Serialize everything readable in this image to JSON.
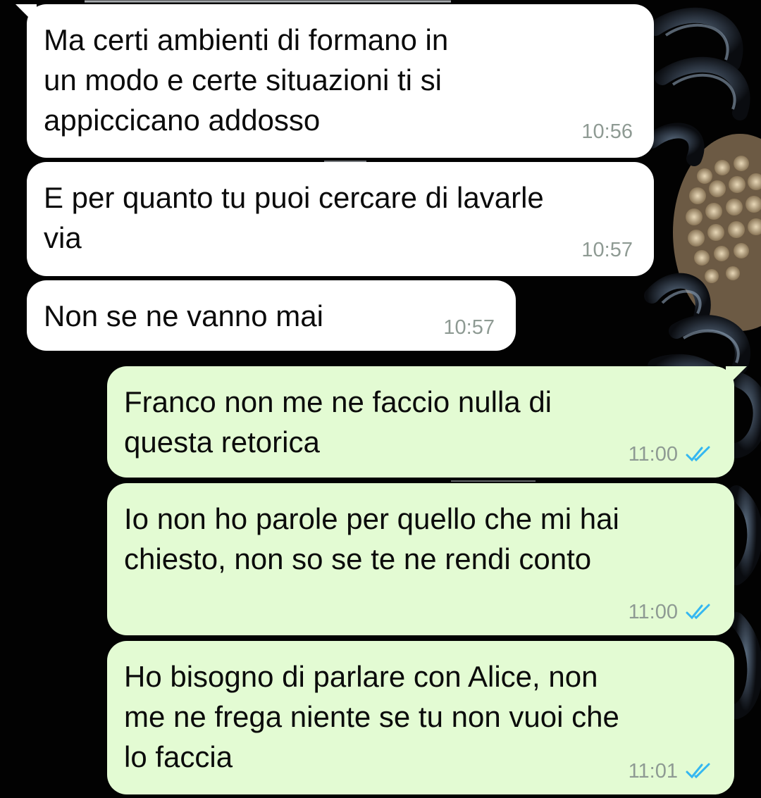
{
  "messages": [
    {
      "direction": "in",
      "text": "Ma certi ambienti di formano in\nun modo e certe situazioni ti si\nappiccicano addosso",
      "time": "10:56"
    },
    {
      "direction": "in",
      "text": "E per quanto tu puoi cercare di lavarle\nvia",
      "time": "10:57"
    },
    {
      "direction": "in",
      "text": "Non se ne vanno mai",
      "time": "10:57"
    },
    {
      "direction": "out",
      "text": "Franco non me ne faccio nulla di\nquesta retorica",
      "time": "11:00",
      "status": "read"
    },
    {
      "direction": "out",
      "text": "Io non ho parole per quello che mi hai\nchiesto, non so se te ne rendi conto",
      "time": "11:00",
      "status": "read"
    },
    {
      "direction": "out",
      "text": "Ho bisogno di parlare con Alice, non\nme ne frega niente se tu non vuoi che\nlo faccia",
      "time": "11:01",
      "status": "read"
    }
  ],
  "colors": {
    "incoming_bubble": "#ffffff",
    "outgoing_bubble": "#e3fbd3",
    "timestamp": "#8e9a93",
    "read_tick": "#34b7f1",
    "wallpaper": "#020202"
  },
  "icons": {
    "read_receipt": "double-check-icon",
    "wallpaper": "dark-flower-wallpaper"
  }
}
